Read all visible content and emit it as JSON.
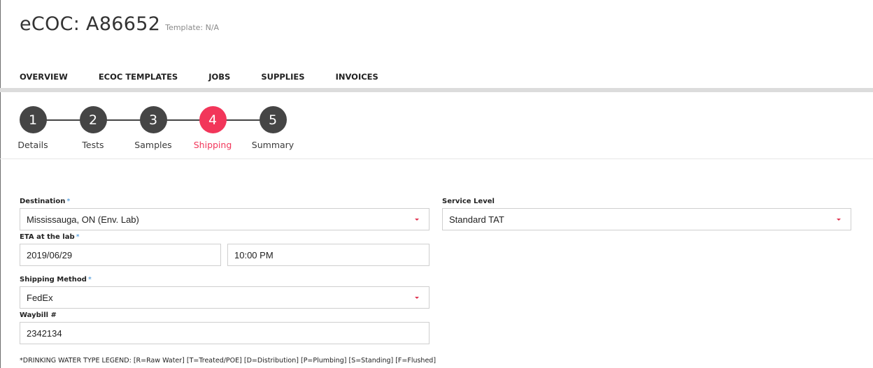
{
  "header": {
    "title": "eCOC: A86652",
    "template_label": "Template: N/A"
  },
  "nav": {
    "items": [
      {
        "label": "OVERVIEW"
      },
      {
        "label": "ECOC TEMPLATES"
      },
      {
        "label": "JOBS"
      },
      {
        "label": "SUPPLIES"
      },
      {
        "label": "INVOICES"
      }
    ]
  },
  "stepper": {
    "active_step": 4,
    "steps": [
      {
        "number": "1",
        "label": "Details"
      },
      {
        "number": "2",
        "label": "Tests"
      },
      {
        "number": "3",
        "label": "Samples"
      },
      {
        "number": "4",
        "label": "Shipping"
      },
      {
        "number": "5",
        "label": "Summary"
      }
    ]
  },
  "form": {
    "required_marker": "*",
    "destination": {
      "label": "Destination",
      "value": "Mississauga, ON (Env. Lab)"
    },
    "service_level": {
      "label": "Service Level",
      "value": "Standard TAT"
    },
    "eta": {
      "label": "ETA at the lab",
      "date": "2019/06/29",
      "time": "10:00 PM"
    },
    "shipping_method": {
      "label": "Shipping Method",
      "value": "FedEx"
    },
    "waybill": {
      "label": "Waybill #",
      "value": "2342134"
    }
  },
  "legend": "*DRINKING WATER TYPE LEGEND: [R=Raw Water] [T=Treated/POE] [D=Distribution] [P=Plumbing] [S=Standing] [F=Flushed]",
  "colors": {
    "accent": "#f2365a",
    "step": "#454545",
    "required": "#3a8fd6"
  }
}
